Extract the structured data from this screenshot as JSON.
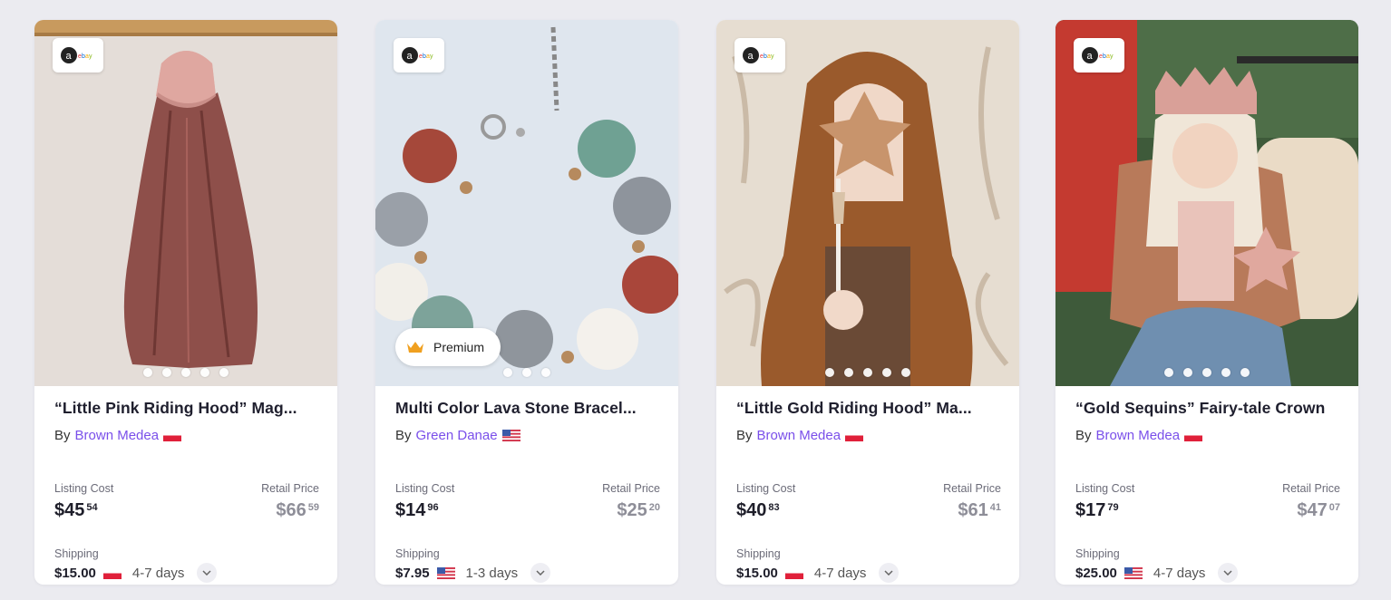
{
  "cards": [
    {
      "title": "“Little Pink Riding Hood” Mag...",
      "by": "By",
      "seller": "Brown Medea",
      "flag": "poland",
      "listing_label": "Listing Cost",
      "listing_dollars": "$45",
      "listing_cents": "54",
      "retail_label": "Retail Price",
      "retail_dollars": "$66",
      "retail_cents": "59",
      "shipping_label": "Shipping",
      "shipping_price": "$15.00",
      "shipping_flag": "poland",
      "shipping_days": "4-7 days",
      "image_dots": 5,
      "image_active_dot": 1,
      "marketplace_icon": "amazon-ebay-logo"
    },
    {
      "title": "Multi Color Lava Stone Bracel...",
      "by": "By",
      "seller": "Green Danae",
      "flag": "usa",
      "listing_label": "Listing Cost",
      "listing_dollars": "$14",
      "listing_cents": "96",
      "retail_label": "Retail Price",
      "retail_dollars": "$25",
      "retail_cents": "20",
      "shipping_label": "Shipping",
      "shipping_price": "$7.95",
      "shipping_flag": "usa",
      "shipping_days": "1-3 days",
      "premium_label": "Premium",
      "image_dots": 3,
      "image_active_dot": 1,
      "marketplace_icon": "amazon-ebay-logo"
    },
    {
      "title": "“Little Gold Riding Hood” Ma...",
      "by": "By",
      "seller": "Brown Medea",
      "flag": "poland",
      "listing_label": "Listing Cost",
      "listing_dollars": "$40",
      "listing_cents": "83",
      "retail_label": "Retail Price",
      "retail_dollars": "$61",
      "retail_cents": "41",
      "shipping_label": "Shipping",
      "shipping_price": "$15.00",
      "shipping_flag": "poland",
      "shipping_days": "4-7 days",
      "image_dots": 5,
      "image_active_dot": 1,
      "marketplace_icon": "amazon-ebay-logo"
    },
    {
      "title": "“Gold Sequins” Fairy-tale Crown",
      "by": "By",
      "seller": "Brown Medea",
      "flag": "poland",
      "listing_label": "Listing Cost",
      "listing_dollars": "$17",
      "listing_cents": "79",
      "retail_label": "Retail Price",
      "retail_dollars": "$47",
      "retail_cents": "07",
      "shipping_label": "Shipping",
      "shipping_price": "$25.00",
      "shipping_flag": "usa",
      "shipping_days": "4-7 days",
      "image_dots": 5,
      "image_active_dot": 1,
      "marketplace_icon": "amazon-ebay-logo"
    }
  ],
  "colors": {
    "page_background": "#ebebf0",
    "seller_link": "#7a4fea",
    "retail_price": "#8e8e98",
    "premium_crown": "#f0a020"
  }
}
